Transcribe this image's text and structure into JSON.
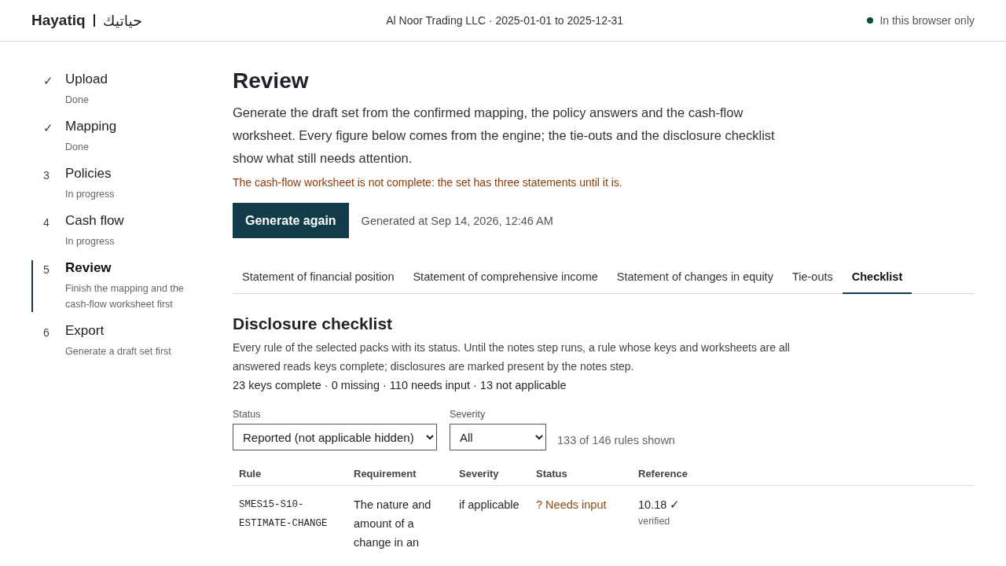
{
  "header": {
    "brand": "Hayatiq",
    "brand_arabic": "حياتيك",
    "context": "Al Noor Trading LLC · 2025-01-01 to 2025-12-31",
    "storage": "In this browser only"
  },
  "steps": [
    {
      "marker": "✓",
      "label": "Upload",
      "status": "Done",
      "kind": "done",
      "selected": false
    },
    {
      "marker": "✓",
      "label": "Mapping",
      "status": "Done",
      "kind": "done",
      "selected": false
    },
    {
      "marker": "3",
      "label": "Policies",
      "status": "In progress",
      "kind": "numbered",
      "selected": false
    },
    {
      "marker": "4",
      "label": "Cash flow",
      "status": "In progress",
      "kind": "numbered",
      "selected": false
    },
    {
      "marker": "5",
      "label": "Review",
      "status": "Finish the mapping and the cash-flow worksheet first",
      "kind": "numbered",
      "selected": true
    },
    {
      "marker": "6",
      "label": "Export",
      "status": "Generate a draft set first",
      "kind": "numbered",
      "selected": false
    }
  ],
  "page": {
    "title": "Review",
    "intro": "Generate the draft set from the confirmed mapping, the policy answers and the cash-flow worksheet. Every figure below comes from the engine; the tie-outs and the disclosure checklist show what still needs attention.",
    "warning": "The cash-flow worksheet is not complete: the set has three statements until it is.",
    "button": "Generate again",
    "generated": "Generated at Sep 14, 2026, 12:46 AM"
  },
  "tabs": [
    {
      "label": "Statement of financial position",
      "selected": false
    },
    {
      "label": "Statement of comprehensive income",
      "selected": false
    },
    {
      "label": "Statement of changes in equity",
      "selected": false
    },
    {
      "label": "Tie-outs",
      "selected": false
    },
    {
      "label": "Checklist",
      "selected": true
    }
  ],
  "checklist": {
    "title": "Disclosure checklist",
    "description": "Every rule of the selected packs with its status. Until the notes step runs, a rule whose keys and worksheets are all answered reads keys complete; disclosures are marked present by the notes step.",
    "summary": "23 keys complete · 0 missing · 110 needs input · 13 not applicable",
    "filters": [
      {
        "label": "Status",
        "value": "Reported (not applicable hidden)"
      },
      {
        "label": "Severity",
        "value": "All"
      }
    ],
    "count": "133 of 146 rules shown",
    "table": {
      "columns": [
        "Rule",
        "Requirement",
        "Severity",
        "Status",
        "Reference"
      ],
      "rows": [
        {
          "rule": "SMES15-S10-ESTIMATE-CHANGE",
          "requirement": "The nature and amount of a change in an",
          "severity": "if applicable",
          "status": "? Needs input",
          "color": "#8a4a0f",
          "reference": "10.18 ✓",
          "reference_note": "verified"
        }
      ]
    }
  }
}
